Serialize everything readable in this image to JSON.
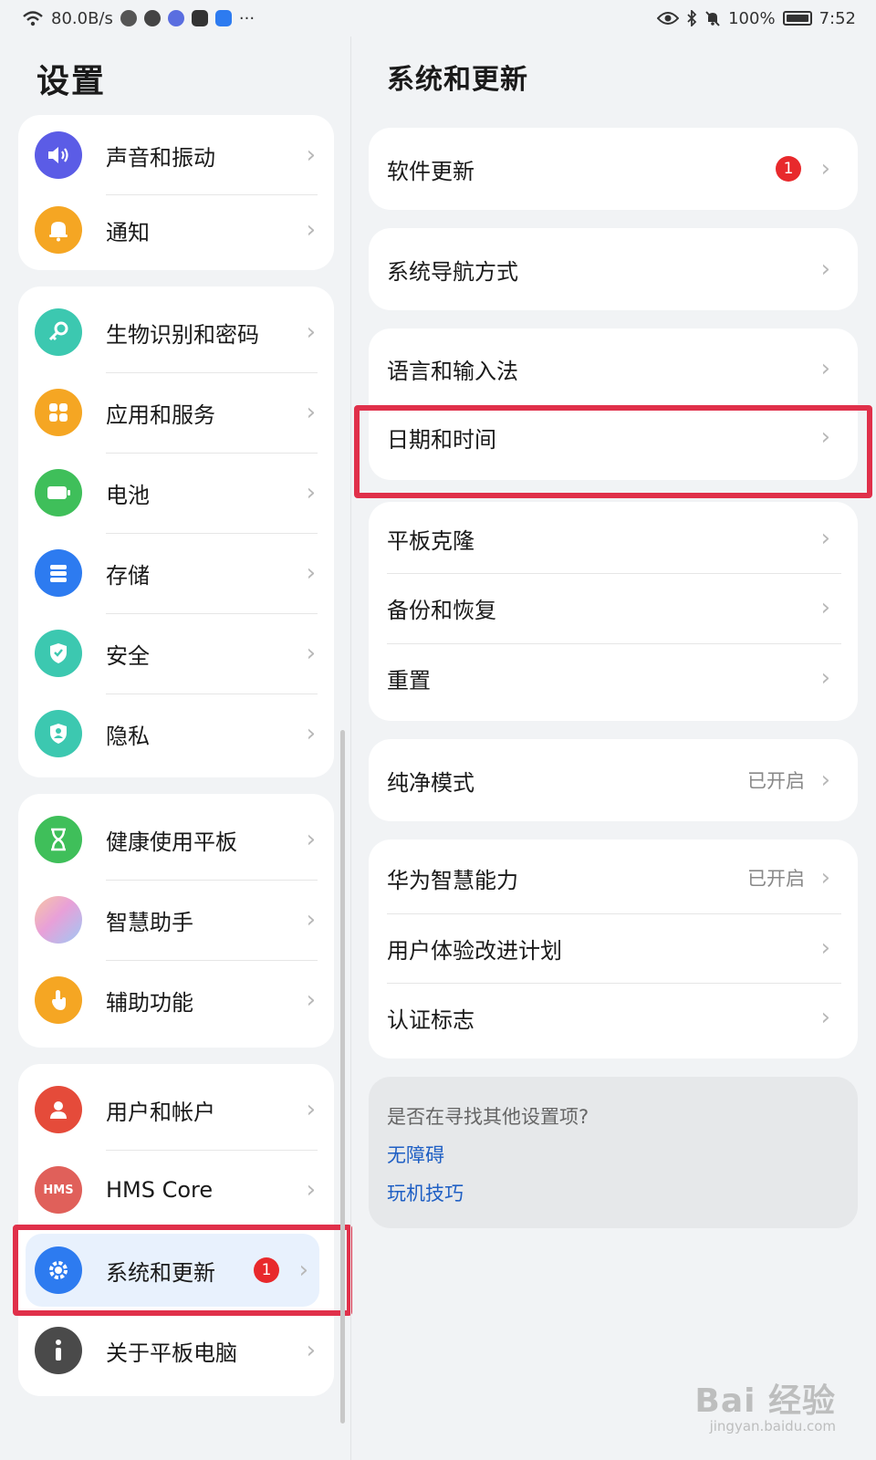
{
  "status_bar": {
    "net_speed": "80.0B/s",
    "more": "···",
    "battery": "100%",
    "time": "7:52"
  },
  "left": {
    "title": "设置",
    "groups": [
      [
        {
          "label": "声音和振动",
          "icon": "speaker-icon",
          "color": "#5b5ce6"
        },
        {
          "label": "通知",
          "icon": "bell-icon",
          "color": "#f5a623"
        }
      ],
      [
        {
          "label": "生物识别和密码",
          "icon": "key-icon",
          "color": "#3cc8b0"
        },
        {
          "label": "应用和服务",
          "icon": "grid-icon",
          "color": "#f5a623"
        },
        {
          "label": "电池",
          "icon": "battery-icon",
          "color": "#3fbf5a"
        },
        {
          "label": "存储",
          "icon": "storage-icon",
          "color": "#2d7bf0"
        },
        {
          "label": "安全",
          "icon": "shield-check-icon",
          "color": "#3cc8b0"
        },
        {
          "label": "隐私",
          "icon": "shield-user-icon",
          "color": "#3cc8b0"
        }
      ],
      [
        {
          "label": "健康使用平板",
          "icon": "hourglass-icon",
          "color": "#3fbf5a"
        },
        {
          "label": "智慧助手",
          "icon": "assistant-orb-icon",
          "color": "#e8a0d8"
        },
        {
          "label": "辅助功能",
          "icon": "hand-icon",
          "color": "#f5a623"
        }
      ],
      [
        {
          "label": "用户和帐户",
          "icon": "user-icon",
          "color": "#e54b3a"
        },
        {
          "label": "HMS Core",
          "icon": "hms-icon",
          "color": "#e0605a",
          "icon_text": "HMS"
        },
        {
          "label": "系统和更新",
          "icon": "gear-icon",
          "color": "#2d7bf0",
          "badge": "1",
          "selected": true
        },
        {
          "label": "关于平板电脑",
          "icon": "info-icon",
          "color": "#4a4a4a"
        }
      ]
    ]
  },
  "right": {
    "title": "系统和更新",
    "groups": [
      [
        {
          "label": "软件更新",
          "badge": "1"
        }
      ],
      [
        {
          "label": "系统导航方式"
        }
      ],
      [
        {
          "label": "语言和输入法"
        },
        {
          "label": "日期和时间"
        }
      ],
      [
        {
          "label": "平板克隆"
        },
        {
          "label": "备份和恢复"
        },
        {
          "label": "重置"
        }
      ],
      [
        {
          "label": "纯净模式",
          "value": "已开启"
        }
      ],
      [
        {
          "label": "华为智慧能力",
          "value": "已开启"
        },
        {
          "label": "用户体验改进计划"
        },
        {
          "label": "认证标志"
        }
      ]
    ],
    "hint": {
      "question": "是否在寻找其他设置项?",
      "links": [
        "无障碍",
        "玩机技巧"
      ]
    }
  },
  "colors": {
    "highlight": "#e0304a",
    "badge": "#e8292c",
    "link": "#1f5fc4",
    "selected_bg": "#e8f1fd"
  },
  "watermark": {
    "main": "Bai 经验",
    "sub": "jingyan.baidu.com"
  }
}
